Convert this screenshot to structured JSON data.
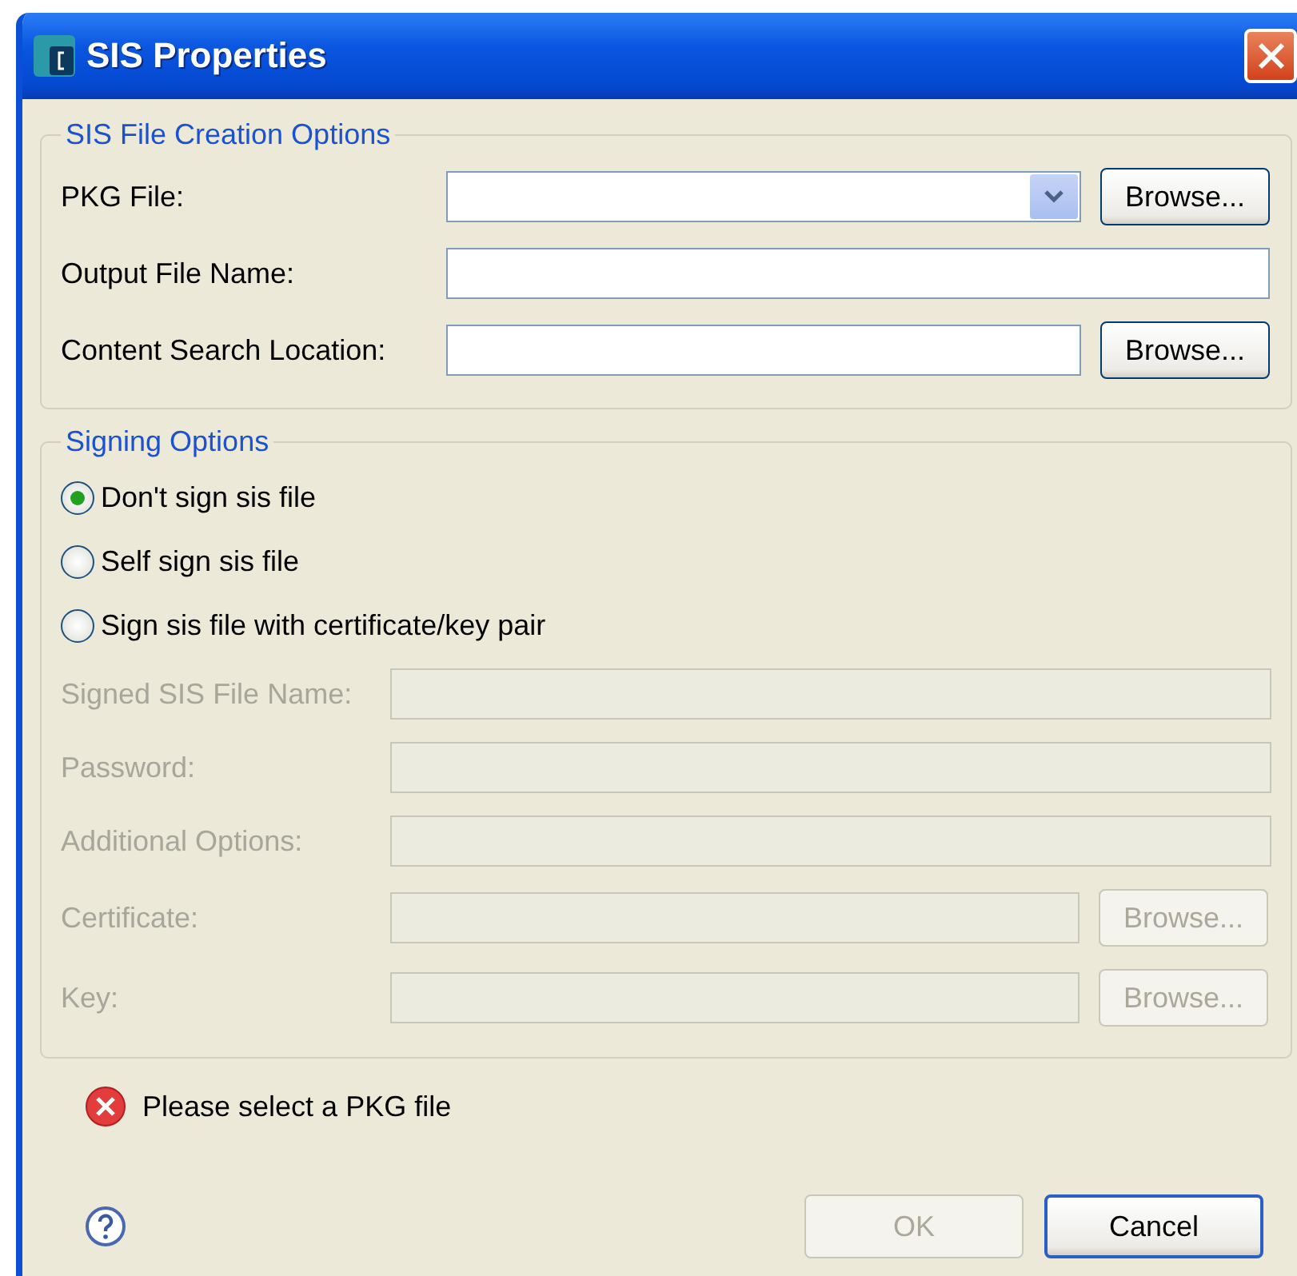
{
  "window": {
    "title": "SIS Properties"
  },
  "creation_options": {
    "title": "SIS File Creation Options",
    "rows": [
      {
        "kind": "combo",
        "label": "PKG File:",
        "button": "Browse..."
      },
      {
        "kind": "text",
        "label": "Output File Name:"
      },
      {
        "kind": "text",
        "label": "Content Search Location:",
        "button": "Browse..."
      }
    ]
  },
  "signing_options": {
    "title": "Signing Options",
    "radios": [
      {
        "label": "Don't sign sis file",
        "selected": true
      },
      {
        "label": "Self sign sis file",
        "selected": false
      },
      {
        "label": "Sign sis file with certificate/key pair",
        "selected": false
      }
    ],
    "fields": [
      {
        "label": "Signed SIS File Name:",
        "disabled": true
      },
      {
        "label": "Password:",
        "disabled": true
      },
      {
        "label": "Additional Options:",
        "disabled": true
      },
      {
        "label": "Certificate:",
        "disabled": true,
        "button": "Browse..."
      },
      {
        "label": "Key:",
        "disabled": true,
        "button": "Browse..."
      }
    ]
  },
  "message": {
    "kind": "error",
    "text": "Please select a PKG file"
  },
  "buttons": [
    {
      "label": "OK",
      "disabled": true,
      "focused": false
    },
    {
      "label": "Cancel",
      "disabled": false,
      "focused": true
    }
  ]
}
